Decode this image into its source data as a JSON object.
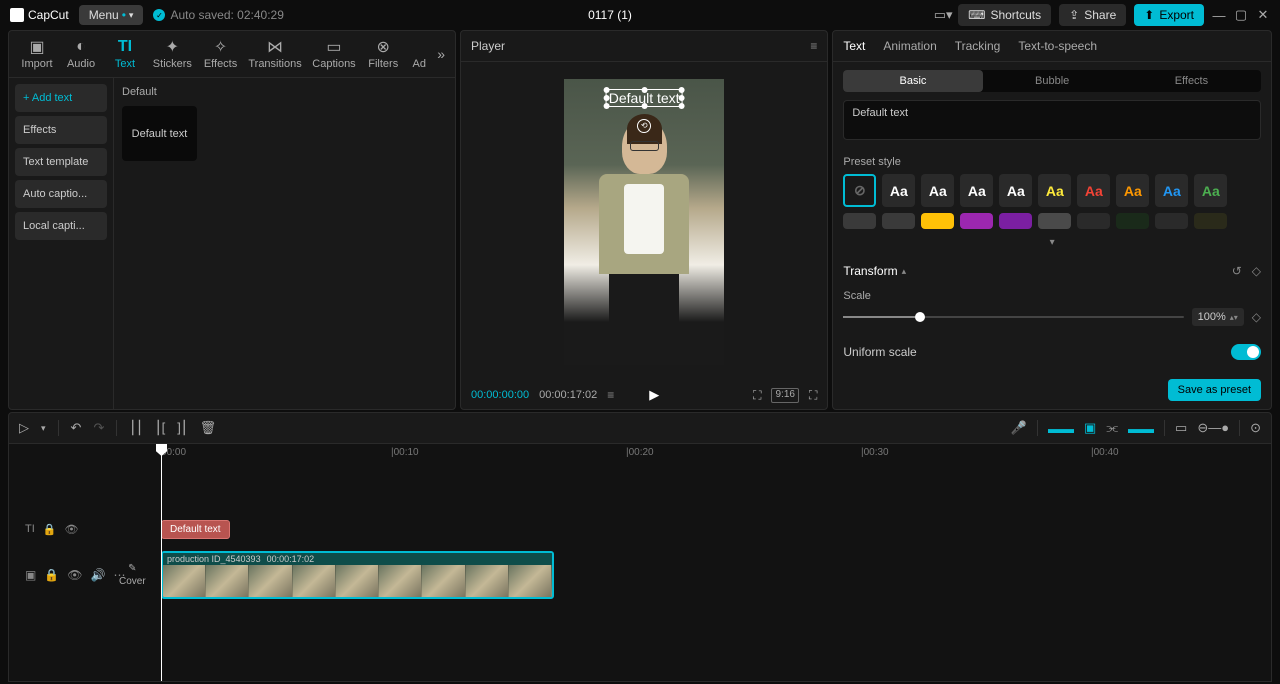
{
  "app": {
    "name": "CapCut",
    "menu": "Menu",
    "autosaved": "Auto saved: 02:40:29",
    "title": "0117 (1)"
  },
  "topbar": {
    "shortcuts": "Shortcuts",
    "share": "Share",
    "export": "Export"
  },
  "tooltabs": {
    "import": "Import",
    "audio": "Audio",
    "text": "Text",
    "stickers": "Stickers",
    "effects": "Effects",
    "transitions": "Transitions",
    "captions": "Captions",
    "filters": "Filters",
    "ad": "Ad"
  },
  "textSide": {
    "add": "+ Add text",
    "effects": "Effects",
    "template": "Text template",
    "autocap": "Auto captio...",
    "localcap": "Local capti..."
  },
  "textContent": {
    "category": "Default",
    "thumb": "Default text"
  },
  "player": {
    "title": "Player",
    "overlay": "Default text",
    "current": "00:00:00:00",
    "total": "00:00:17:02",
    "ratio": "9:16"
  },
  "ruler": {
    "t0": "00:00",
    "t10": "|00:10",
    "t20": "|00:20",
    "t30": "|00:30",
    "t40": "|00:40"
  },
  "rightTabs": {
    "text": "Text",
    "animation": "Animation",
    "tracking": "Tracking",
    "tts": "Text-to-speech"
  },
  "subTabs": {
    "basic": "Basic",
    "bubble": "Bubble",
    "effects": "Effects"
  },
  "textValue": "Default text",
  "presetLabel": "Preset style",
  "presets": {
    "aa": "Aa"
  },
  "transform": {
    "title": "Transform",
    "scale": "Scale",
    "value": "100%",
    "uniform": "Uniform scale"
  },
  "savePreset": "Save as preset",
  "timeline": {
    "textClip": "Default text",
    "coverLabel": "Cover",
    "clipName": "production ID_4540393",
    "clipDur": "00:00:17:02"
  }
}
